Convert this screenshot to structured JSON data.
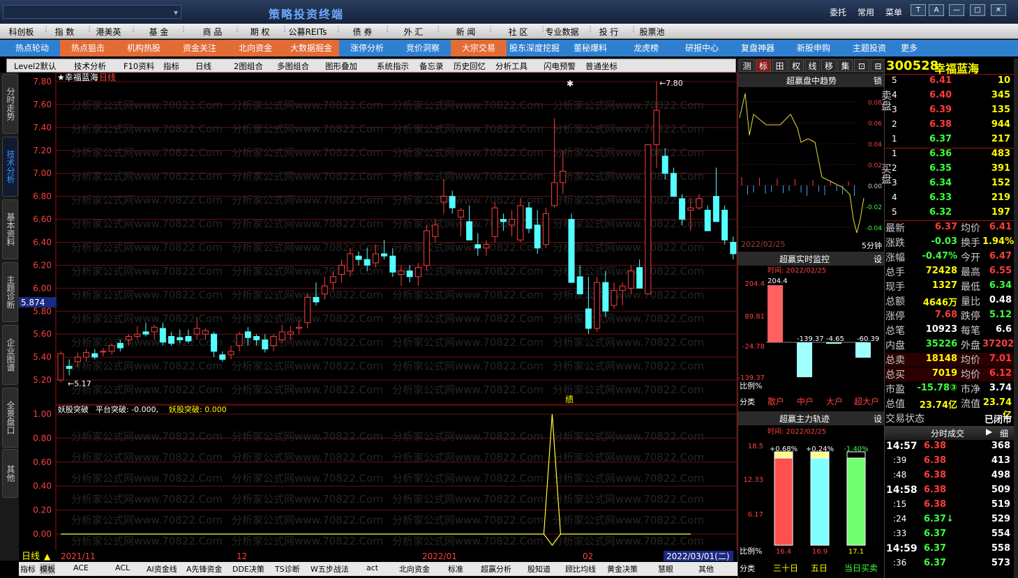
{
  "window": {
    "title": "策略投资终端",
    "links": [
      "委托",
      "常用",
      "菜单"
    ],
    "buttons": [
      "T",
      "A",
      "—",
      "□",
      "✕"
    ]
  },
  "menu": [
    "科创板",
    "指 数",
    "港美英",
    "基 金",
    "商 品",
    "期 权",
    "公募REITs",
    "债 券",
    "外 汇",
    "新 闻",
    "社 区",
    "专业数据",
    "投 行",
    "股票池"
  ],
  "hot": [
    {
      "label": "热点轮动",
      "orange": false
    },
    {
      "label": "热点狙击",
      "orange": true
    },
    {
      "label": "机构热股",
      "orange": true
    },
    {
      "label": "资金关注",
      "orange": true
    },
    {
      "label": "北向资金",
      "orange": true
    },
    {
      "label": "大数据掘金",
      "orange": true
    },
    {
      "label": "涨停分析",
      "orange": false
    },
    {
      "label": "竞价洞察",
      "orange": false
    },
    {
      "label": "大宗交易",
      "orange": true
    },
    {
      "label": "股东深度挖掘",
      "orange": false
    },
    {
      "label": "董秘爆料",
      "orange": false
    },
    {
      "label": "龙虎榜",
      "orange": false
    },
    {
      "label": "研报中心",
      "orange": false
    },
    {
      "label": "复盘神器",
      "orange": false
    },
    {
      "label": "新股申购",
      "orange": false
    },
    {
      "label": "主题投资",
      "orange": false
    },
    {
      "label": "更多",
      "orange": false
    }
  ],
  "toolbar": [
    "Level2默认",
    "技术分析",
    "F10资料",
    "指标",
    "日线",
    "2图组合",
    "多图组合",
    "图形叠加",
    "系统指示",
    "备忘录",
    "历史回忆",
    "分析工具",
    "闪电预警",
    "普通坐标"
  ],
  "sidetabs": [
    "分时走势",
    "技术分析",
    "基本资料",
    "主题诊断",
    "企业图谱",
    "全景盘口",
    "其他"
  ],
  "chart": {
    "title": "★幸福蓝海",
    "period": "日线",
    "cursor_price": "5.874",
    "high_label": "7.80",
    "low_label": "5.17",
    "marker": "绩",
    "yticks": [
      "7.80",
      "7.60",
      "7.40",
      "7.20",
      "7.00",
      "6.80",
      "6.60",
      "6.40",
      "6.20",
      "6.00",
      "5.80",
      "5.60",
      "5.40",
      "5.20"
    ],
    "sub_title": "妖股突破",
    "sub_line1": "平台突破: -0.000,",
    "sub_line2": "妖股突破: 0.000",
    "sub_yticks": [
      "1.00",
      "0.80",
      "0.60",
      "0.40",
      "0.20",
      "0.00"
    ],
    "dates": [
      "2021/11",
      "12",
      "2022/01",
      "02",
      "2022/03/01(二)"
    ],
    "period_label": "日线"
  },
  "chart_data": {
    "type": "candlestick",
    "ylim": [
      5.17,
      7.8
    ],
    "candles": [
      [
        5.2,
        5.45,
        5.18,
        5.43
      ],
      [
        5.32,
        5.38,
        5.24,
        5.3
      ],
      [
        5.36,
        5.44,
        5.31,
        5.4
      ],
      [
        5.4,
        5.47,
        5.36,
        5.44
      ],
      [
        5.43,
        5.47,
        5.38,
        5.4
      ],
      [
        5.45,
        5.48,
        5.41,
        5.45
      ],
      [
        5.45,
        5.52,
        5.42,
        5.5
      ],
      [
        5.52,
        5.55,
        5.45,
        5.48
      ],
      [
        5.55,
        5.6,
        5.5,
        5.58
      ],
      [
        5.58,
        5.67,
        5.55,
        5.6
      ],
      [
        5.62,
        5.7,
        5.58,
        5.6
      ],
      [
        5.62,
        5.68,
        5.55,
        5.66
      ],
      [
        5.65,
        5.7,
        5.5,
        5.53
      ],
      [
        5.58,
        5.62,
        5.5,
        5.52
      ],
      [
        5.57,
        5.64,
        5.52,
        5.55
      ],
      [
        5.58,
        5.64,
        5.52,
        5.54
      ],
      [
        5.6,
        5.75,
        5.55,
        5.65
      ],
      [
        5.6,
        5.65,
        5.55,
        5.63
      ],
      [
        5.6,
        5.62,
        5.4,
        5.45
      ],
      [
        5.42,
        5.45,
        5.36,
        5.38
      ],
      [
        5.42,
        5.5,
        5.38,
        5.45
      ],
      [
        5.5,
        5.62,
        5.45,
        5.6
      ],
      [
        5.62,
        5.66,
        5.5,
        5.57
      ],
      [
        5.58,
        5.6,
        5.5,
        5.55
      ],
      [
        5.55,
        5.6,
        5.44,
        5.47
      ],
      [
        5.5,
        5.6,
        5.45,
        5.58
      ],
      [
        5.55,
        5.68,
        5.52,
        5.62
      ],
      [
        5.6,
        5.67,
        5.55,
        5.62
      ],
      [
        5.65,
        5.72,
        5.6,
        5.66
      ],
      [
        5.7,
        5.95,
        5.65,
        5.92
      ],
      [
        5.92,
        6.05,
        5.85,
        5.88
      ],
      [
        5.95,
        6.1,
        5.9,
        6.02
      ],
      [
        6.05,
        6.15,
        5.98,
        6.1
      ],
      [
        6.12,
        6.25,
        6.05,
        6.2
      ],
      [
        6.15,
        6.35,
        6.1,
        6.3
      ],
      [
        6.28,
        6.32,
        6.2,
        6.25
      ],
      [
        6.25,
        6.35,
        6.15,
        6.2
      ],
      [
        6.22,
        6.38,
        6.18,
        6.3
      ],
      [
        6.3,
        6.42,
        6.25,
        6.28
      ],
      [
        6.28,
        6.35,
        6.1,
        6.14
      ],
      [
        6.12,
        6.2,
        6.02,
        6.15
      ],
      [
        6.15,
        6.2,
        6.05,
        6.1
      ],
      [
        6.1,
        6.22,
        6.02,
        6.18
      ],
      [
        6.2,
        6.55,
        6.15,
        6.5
      ],
      [
        6.45,
        6.6,
        6.4,
        6.55
      ],
      [
        6.75,
        6.95,
        6.65,
        6.8
      ],
      [
        6.8,
        6.85,
        6.65,
        6.7
      ],
      [
        6.62,
        6.7,
        6.45,
        6.68
      ],
      [
        6.58,
        6.72,
        6.45,
        6.42
      ],
      [
        6.38,
        6.48,
        6.28,
        6.35
      ],
      [
        6.35,
        6.42,
        6.28,
        6.38
      ],
      [
        6.45,
        6.75,
        6.4,
        6.7
      ],
      [
        6.6,
        6.65,
        6.5,
        6.58
      ],
      [
        6.55,
        6.68,
        6.45,
        6.6
      ],
      [
        6.42,
        6.78,
        6.4,
        6.72
      ],
      [
        6.7,
        6.75,
        6.48,
        6.52
      ],
      [
        6.55,
        6.68,
        6.3,
        6.35
      ],
      [
        6.38,
        6.7,
        6.35,
        6.65
      ],
      [
        6.72,
        7.48,
        6.7,
        6.92
      ],
      [
        6.92,
        7.2,
        6.82,
        7.02
      ],
      [
        6.6,
        6.65,
        6.05,
        6.05
      ],
      [
        6.1,
        6.2,
        5.95,
        5.95
      ],
      [
        5.82,
        6.1,
        5.6,
        5.65
      ],
      [
        5.65,
        6.1,
        5.62,
        6.05
      ],
      [
        6.05,
        6.15,
        5.75,
        5.8
      ],
      [
        5.85,
        6.05,
        5.82,
        5.98
      ],
      [
        5.98,
        6.05,
        5.85,
        6.02
      ],
      [
        6.0,
        6.2,
        5.95,
        6.15
      ],
      [
        6.18,
        6.25,
        6.0,
        6.0
      ],
      [
        5.95,
        7.25,
        5.95,
        7.25
      ],
      [
        7.25,
        7.8,
        7.05,
        7.55
      ],
      [
        7.15,
        7.22,
        6.95,
        7.0
      ],
      [
        7.0,
        7.05,
        6.8,
        6.8
      ],
      [
        6.78,
        6.82,
        6.55,
        6.6
      ],
      [
        6.68,
        6.78,
        6.5,
        6.7
      ],
      [
        6.7,
        6.82,
        6.68,
        6.78
      ],
      [
        6.68,
        6.72,
        6.5,
        6.5
      ],
      [
        6.8,
        7.05,
        6.6,
        6.58
      ],
      [
        6.68,
        6.72,
        6.38,
        6.42
      ],
      [
        6.4,
        6.45,
        6.25,
        6.3
      ]
    ],
    "signal": {
      "index": 27,
      "value": 1.0
    },
    "sub_ylim": [
      0,
      1
    ]
  },
  "right_tabs": [
    "测",
    "标",
    "田",
    "权",
    "线",
    "移",
    "集",
    "⊡",
    "⊟"
  ],
  "stock": {
    "code": "300528",
    "name": "幸福蓝海"
  },
  "intraday": {
    "title": "超赢盘中趋势",
    "lock": "锁",
    "pct": [
      "0.08",
      "0.06",
      "0.04",
      "0.02",
      "0.00",
      "-0.02",
      "-0.04"
    ],
    "date": "2022/02/25",
    "period": "5分钟"
  },
  "monitor": {
    "title": "超赢实时监控",
    "setting": "设",
    "time": "时间: 2022/02/25",
    "yvals": [
      "204.4",
      "89.81",
      "-24.78",
      "-139.37"
    ],
    "labels": [
      "204.4",
      "-139.37",
      "-4.65",
      "-60.39"
    ],
    "cats": [
      "散户",
      "中户",
      "大户",
      "超大户"
    ],
    "ratio": "比例%",
    "class": "分类"
  },
  "track": {
    "title": "超赢主力轨迹",
    "setting": "设",
    "time": "时间: 2022/02/25",
    "yvals": [
      "18.5",
      "12.33",
      "6.17"
    ],
    "tops": [
      "+0.68%",
      "+0.24%",
      "-1.40%"
    ],
    "bottoms": [
      "16.4",
      "16.9",
      "17.1"
    ],
    "cats": [
      "三十日",
      "五日",
      "当日买卖"
    ],
    "ratio": "比例%",
    "class": "分类"
  },
  "orderbook": {
    "sell": [
      [
        "5",
        "6.41",
        "10"
      ],
      [
        "4",
        "6.40",
        "345"
      ],
      [
        "3",
        "6.39",
        "135"
      ],
      [
        "2",
        "6.38",
        "944"
      ],
      [
        "1",
        "6.37",
        "217"
      ]
    ],
    "buy": [
      [
        "1",
        "6.36",
        "483"
      ],
      [
        "2",
        "6.35",
        "391"
      ],
      [
        "3",
        "6.34",
        "152"
      ],
      [
        "4",
        "6.33",
        "219"
      ],
      [
        "5",
        "6.32",
        "197"
      ]
    ],
    "sell_label": "卖盘",
    "buy_label": "买盘"
  },
  "quote": [
    [
      "最新",
      "6.37",
      "均价",
      "6.41"
    ],
    [
      "涨跌",
      "-0.03",
      "换手",
      "1.94%"
    ],
    [
      "涨幅",
      "-0.47%",
      "今开",
      "6.47"
    ],
    [
      "总手",
      "72428",
      "最高",
      "6.55"
    ],
    [
      "现手",
      "1327",
      "最低",
      "6.34"
    ],
    [
      "总额",
      "4646万",
      "量比",
      "0.48"
    ],
    [
      "涨停",
      "7.68",
      "跌停",
      "5.12"
    ],
    [
      "总笔",
      "10923",
      "每笔",
      "6.6"
    ],
    [
      "内盘",
      "35226",
      "外盘",
      "37202"
    ],
    [
      "总卖",
      "18148",
      "均价",
      "7.01"
    ],
    [
      "总买",
      "7019",
      "均价",
      "6.12"
    ],
    [
      "市盈",
      "-15.78③",
      "市净",
      "3.74"
    ],
    [
      "总值",
      "23.74亿",
      "流值",
      "23.74亿"
    ],
    [
      "交易状态",
      "",
      "",
      "已闭市"
    ]
  ],
  "ticks": {
    "title": "分时成交",
    "detail": "细",
    "rows": [
      [
        "14:57",
        "6.38",
        "368"
      ],
      [
        ":39",
        "6.38",
        "413"
      ],
      [
        ":48",
        "6.38",
        "498"
      ],
      [
        "14:58",
        "6.38",
        "509"
      ],
      [
        ":15",
        "6.38",
        "519"
      ],
      [
        ":24",
        "6.37↓",
        "529"
      ],
      [
        ":33",
        "6.37",
        "554"
      ],
      [
        "14:59",
        "6.37",
        "558"
      ],
      [
        ":36",
        "6.37",
        "573"
      ]
    ]
  },
  "indicators": [
    "指标",
    "模板",
    "ACE",
    "ACL",
    "AI资金线",
    "A先锋资金",
    "DDE决策",
    "TS诊断",
    "W五步战法",
    "act",
    "北向资金",
    "标准",
    "超赢分析",
    "股知道",
    "顾比均线",
    "黄金决策",
    "慧眼",
    "其他"
  ],
  "watermark": "分析家公式网www.70822.Com"
}
